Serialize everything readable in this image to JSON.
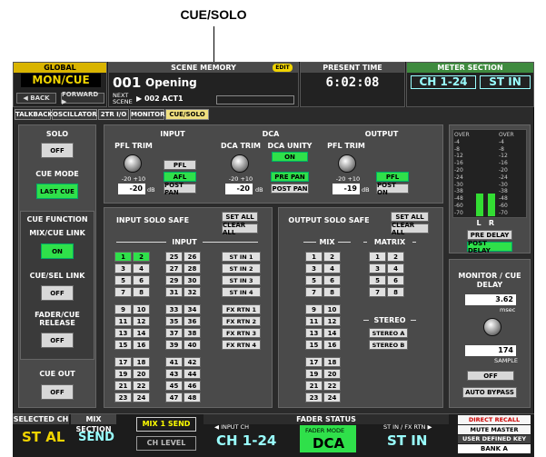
{
  "callout": "CUE/SOLO",
  "topbar": {
    "global_label": "GLOBAL",
    "mon_cue": "MON/CUE",
    "back": "◀ BACK",
    "forward": "FORWARD ▶",
    "scene_memory_label": "SCENE MEMORY",
    "edit": "EDIT",
    "scene_number": "001",
    "scene_name": "Opening",
    "next_scene_label": "NEXT SCENE",
    "next_scene": "▶ 002 ACT1",
    "present_time_label": "PRESENT TIME",
    "present_time": "6:02:08",
    "meter_section_label": "METER SECTION",
    "meter_ch": "CH 1-24",
    "meter_st": "ST IN"
  },
  "tabs": [
    "TALKBACK",
    "OSCILLATOR",
    "2TR I/O",
    "MONITOR",
    "CUE/SOLO"
  ],
  "left": {
    "solo_label": "SOLO",
    "solo_btn": "OFF",
    "cue_mode_label": "CUE MODE",
    "cue_mode_btn": "LAST CUE",
    "cue_function_label": "CUE FUNCTION",
    "mix_cue_link_label": "MIX/CUE LINK",
    "mix_cue_link_btn": "ON",
    "cue_sel_link_label": "CUE/SEL LINK",
    "cue_sel_link_btn": "OFF",
    "fader_cue_release_label": "FADER/CUE RELEASE",
    "fader_cue_release_btn": "OFF",
    "cue_out_label": "CUE OUT",
    "cue_out_btn": "OFF"
  },
  "input": {
    "title": "INPUT",
    "pfl_trim": "PFL TRIM",
    "range": "-20   +10",
    "value": "-20",
    "unit": "dB",
    "pfl": "PFL",
    "afl": "AFL",
    "post_pan": "POST PAN"
  },
  "dca": {
    "title": "DCA",
    "dca_trim": "DCA TRIM",
    "dca_unity": "DCA UNITY",
    "on": "ON",
    "range": "-20   +10",
    "value": "-20",
    "unit": "dB",
    "pre_pan": "PRE PAN",
    "post_pan": "POST PAN"
  },
  "output": {
    "title": "OUTPUT",
    "pfl_trim": "PFL TRIM",
    "range": "-20   +10",
    "value": "-19",
    "unit": "dB",
    "pfl": "PFL",
    "post_on": "POST ON"
  },
  "input_solo_safe": {
    "title": "INPUT SOLO SAFE",
    "set_all": "SET ALL",
    "clear_all": "CLEAR ALL",
    "input_label": "INPUT",
    "col1": [
      "1",
      "3",
      "5",
      "7",
      "9",
      "11",
      "13",
      "15",
      "17",
      "19",
      "21",
      "23"
    ],
    "col2": [
      "2",
      "4",
      "6",
      "8",
      "10",
      "12",
      "14",
      "16",
      "18",
      "20",
      "22",
      "24"
    ],
    "col3": [
      "25",
      "27",
      "29",
      "31",
      "33",
      "35",
      "37",
      "39",
      "41",
      "43",
      "45",
      "47"
    ],
    "col4": [
      "26",
      "28",
      "30",
      "32",
      "34",
      "36",
      "38",
      "40",
      "42",
      "44",
      "46",
      "48"
    ],
    "st": [
      "ST IN 1",
      "ST IN 2",
      "ST IN 3",
      "ST IN 4"
    ],
    "fx": [
      "FX RTN 1",
      "FX RTN 2",
      "FX RTN 3",
      "FX RTN 4"
    ]
  },
  "output_solo_safe": {
    "title": "OUTPUT SOLO SAFE",
    "set_all": "SET ALL",
    "clear_all": "CLEAR ALL",
    "mix_label": "MIX",
    "matrix_label": "MATRIX",
    "mix_a": [
      "1",
      "3",
      "5",
      "7",
      "9",
      "11",
      "13",
      "15",
      "17",
      "19",
      "21",
      "23"
    ],
    "mix_b": [
      "2",
      "4",
      "6",
      "8",
      "10",
      "12",
      "14",
      "16",
      "18",
      "20",
      "22",
      "24"
    ],
    "matrix_a": [
      "1",
      "3",
      "5",
      "7"
    ],
    "matrix_b": [
      "2",
      "4",
      "6",
      "8"
    ],
    "stereo_label": "STEREO",
    "stereo": [
      "STEREO A",
      "STEREO B"
    ]
  },
  "meter": {
    "scale": [
      "OVER",
      "-4",
      "-8",
      "-12",
      "-16",
      "-20",
      "-24",
      "-30",
      "-38",
      "-48",
      "-60",
      "-70"
    ],
    "l": "L",
    "r": "R",
    "pre_delay": "PRE DELAY",
    "post_delay": "POST DELAY",
    "level_l": 0.27,
    "level_r": 0.27
  },
  "delay": {
    "title": "MONITOR / CUE DELAY",
    "value": "3.62",
    "unit": "msec",
    "samples": "174",
    "sample_unit": "SAMPLE",
    "off": "OFF",
    "auto_bypass": "AUTO BYPASS"
  },
  "bottom": {
    "selected_ch_label": "SELECTED CH",
    "selected_ch": "ST AL",
    "mix_section_label": "MIX SECTION",
    "send": "SEND",
    "mix1_send": "MIX 1 SEND",
    "ch_level": "CH LEVEL",
    "fader_status_label": "FADER STATUS",
    "input_ch_label": "◀ INPUT CH",
    "st_fx_label": "ST IN / FX RTN ▶",
    "ch": "CH 1-24",
    "fader_mode": "FADER MODE",
    "dca": "DCA",
    "st_in": "ST IN",
    "direct_recall": "DIRECT RECALL",
    "mute_master": "MUTE MASTER",
    "user_defined_key": "USER DEFINED KEY",
    "bank": "BANK A"
  }
}
